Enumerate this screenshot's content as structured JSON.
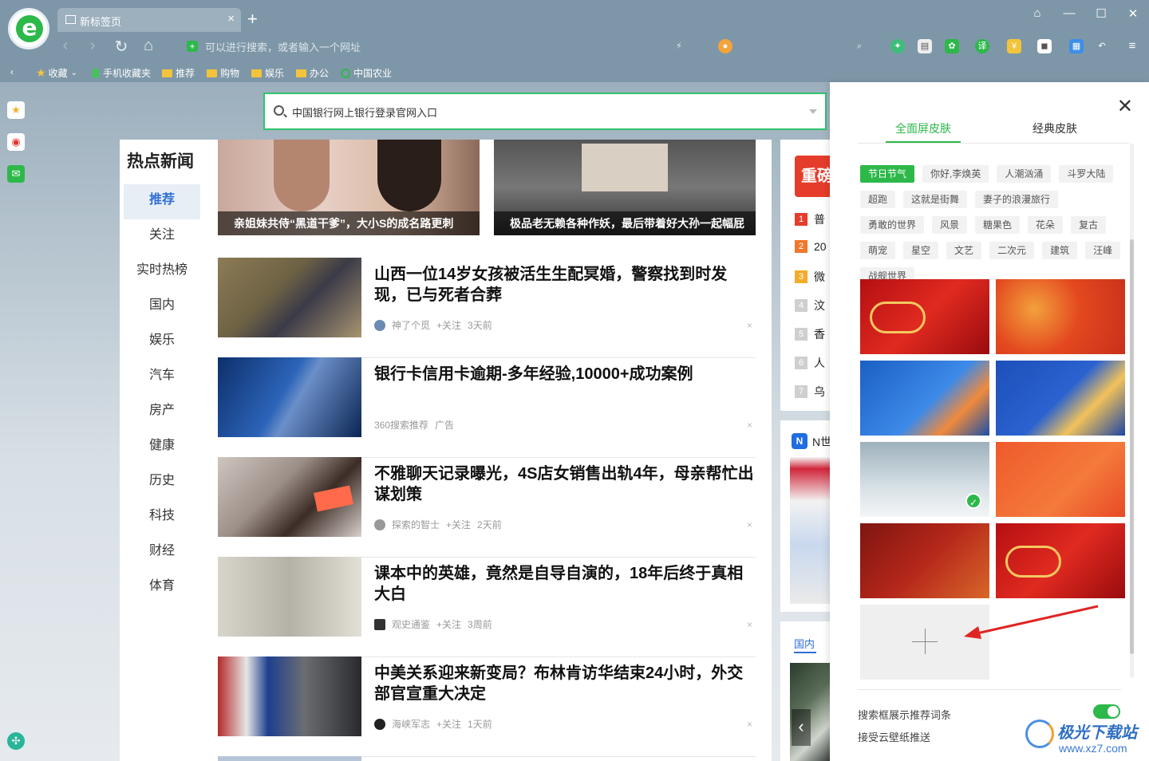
{
  "browser": {
    "tab_title": "新标签页",
    "address_placeholder": "可以进行搜索，或者输入一个网址",
    "bookmarks": [
      "收藏",
      "手机收藏夹",
      "推荐",
      "购物",
      "娱乐",
      "办公",
      "中国农业"
    ]
  },
  "search": {
    "value": "中国银行网上银行登录官网入口"
  },
  "news": {
    "header": "热点新闻",
    "categories": [
      "推荐",
      "关注",
      "实时热榜",
      "国内",
      "娱乐",
      "汽车",
      "房产",
      "健康",
      "历史",
      "科技",
      "财经",
      "体育"
    ],
    "banners": [
      {
        "caption": "亲姐妹共侍“黑道干爹”，大小S的成名路更刺"
      },
      {
        "caption": "极品老无赖各种作妖，最后带着好大孙一起幅屁"
      }
    ],
    "items": [
      {
        "title": "山西一位14岁女孩被活生生配冥婚，警察找到时发现，已与死者合葬",
        "source": "神了个觅",
        "follow": "+关注",
        "time": "3天前"
      },
      {
        "title": "银行卡信用卡逾期-多年经验,10000+成功案例",
        "source": "360搜索推荐",
        "follow": "广告",
        "time": ""
      },
      {
        "title": "不雅聊天记录曝光，4S店女销售出轨4年，母亲帮忙出谋划策",
        "source": "探索的智士",
        "follow": "+关注",
        "time": "2天前"
      },
      {
        "title": "课本中的英雄，竟然是自导自演的，18年后终于真相大白",
        "source": "观史通鉴",
        "follow": "+关注",
        "time": "3周前"
      },
      {
        "title": "中美关系迎来新变局？布林肯访华结束24小时，外交部官宣重大决定",
        "source": "海峡军志",
        "follow": "+关注",
        "time": "1天前"
      }
    ],
    "close_mark": "×"
  },
  "right_column": {
    "banner_text": "重磅",
    "hot_list": [
      {
        "rank": "1",
        "text": "普"
      },
      {
        "rank": "2",
        "text": "20"
      },
      {
        "rank": "3",
        "text": "微"
      },
      {
        "rank": "4",
        "text": "汶"
      },
      {
        "rank": "5",
        "text": "香"
      },
      {
        "rank": "6",
        "text": "人"
      },
      {
        "rank": "7",
        "text": "乌"
      }
    ],
    "section_title": "N世",
    "tab_label": "国内"
  },
  "skin_drawer": {
    "tabs": [
      "全面屏皮肤",
      "经典皮肤"
    ],
    "active_tab": 0,
    "tags": [
      "节日节气",
      "你好,李焕英",
      "人潮汹涌",
      "斗罗大陆",
      "超跑",
      "这就是街舞",
      "妻子的浪漫旅行",
      "勇敢的世界",
      "风景",
      "糖果色",
      "花朵",
      "复古",
      "萌宠",
      "星空",
      "文艺",
      "二次元",
      "建筑",
      "汪峰",
      "战舰世界"
    ],
    "active_tag": 0,
    "selected_skin": 4,
    "settings": [
      "搜索框展示推荐词条",
      "接受云壁纸推送"
    ],
    "toggle_on": true
  },
  "watermark": {
    "name": "极光下载站",
    "url": "www.xz7.com"
  },
  "colors": {
    "accent": "#2db84a",
    "link": "#2f6ed6"
  }
}
